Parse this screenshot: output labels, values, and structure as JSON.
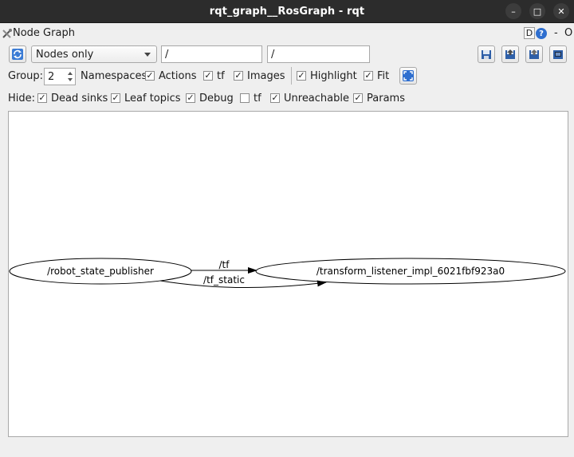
{
  "window": {
    "title": "rqt_graph__RosGraph - rqt",
    "buttons": {
      "minimize": "–",
      "maximize": "□",
      "close": "✕"
    }
  },
  "plugin": {
    "title": "Node Graph",
    "d_label": "D",
    "help_label": "?",
    "dash": "-",
    "o_label": "O"
  },
  "toolbar": {
    "refresh_icon": "refresh-icon",
    "mode_select": "Nodes only",
    "filter_nodes_value": "/",
    "filter_topics_value": "/",
    "right_icons": [
      "load-dot-icon",
      "save-dot-icon",
      "save-svg-icon",
      "save-image-icon"
    ]
  },
  "options": {
    "group_label": "Group:",
    "group_value": "2",
    "items": [
      {
        "label": "Namespaces",
        "checked": true
      },
      {
        "label": "Actions",
        "checked": true
      },
      {
        "label": "tf",
        "checked": true
      },
      {
        "label": "Images",
        "checked": true
      },
      {
        "label": "Highlight",
        "checked": true
      },
      {
        "label": "Fit",
        "checked": true
      }
    ]
  },
  "hide": {
    "label": "Hide:",
    "items": [
      {
        "label": "Dead sinks",
        "checked": true
      },
      {
        "label": "Leaf topics",
        "checked": true
      },
      {
        "label": "Debug",
        "checked": true
      },
      {
        "label": "tf",
        "checked": false
      },
      {
        "label": "Unreachable",
        "checked": true
      },
      {
        "label": "Params",
        "checked": true
      }
    ]
  },
  "graph": {
    "nodes": [
      {
        "id": "robot_state_publisher",
        "label": "/robot_state_publisher"
      },
      {
        "id": "transform_listener",
        "label": "/transform_listener_impl_6021fbf923a0"
      }
    ],
    "edges": [
      {
        "from": "robot_state_publisher",
        "to": "transform_listener",
        "label": "/tf"
      },
      {
        "from": "robot_state_publisher",
        "to": "transform_listener",
        "label": "/tf_static"
      }
    ]
  }
}
